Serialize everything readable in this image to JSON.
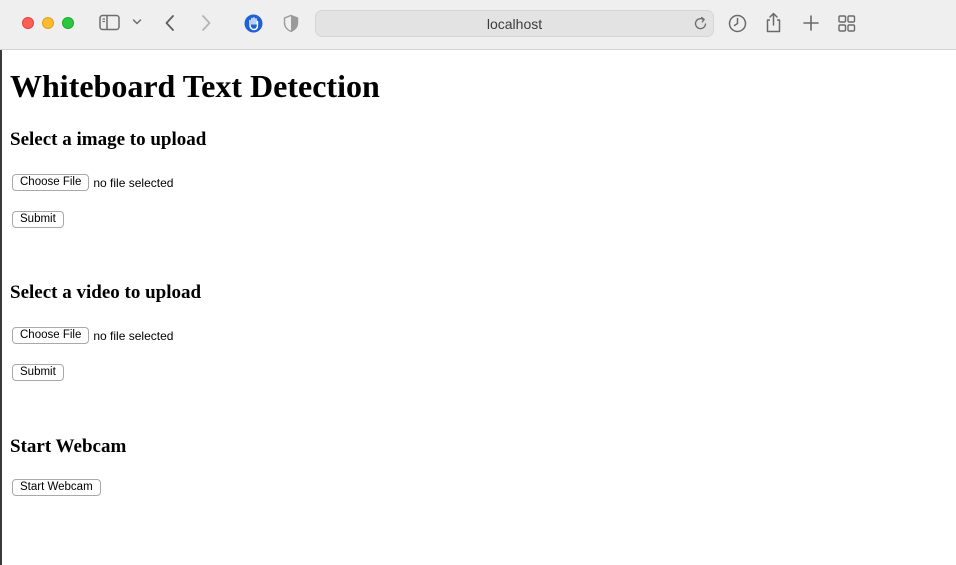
{
  "browser": {
    "url": "localhost",
    "icons": [
      "close-window",
      "minimize-window",
      "zoom-window",
      "sidebar-icon",
      "chevron-down-icon",
      "back-icon",
      "forward-icon",
      "hand-icon",
      "shield-icon",
      "reload-icon",
      "history-icon",
      "share-icon",
      "plus-icon",
      "tabs-overview-icon"
    ]
  },
  "page": {
    "title": "Whiteboard Text Detection",
    "image_section": {
      "heading": "Select a image to upload",
      "choose_label": "Choose File",
      "file_status": "no file selected",
      "submit_label": "Submit"
    },
    "video_section": {
      "heading": "Select a video to upload",
      "choose_label": "Choose File",
      "file_status": "no file selected",
      "submit_label": "Submit"
    },
    "webcam_section": {
      "heading": "Start Webcam",
      "button_label": "Start Webcam"
    }
  }
}
